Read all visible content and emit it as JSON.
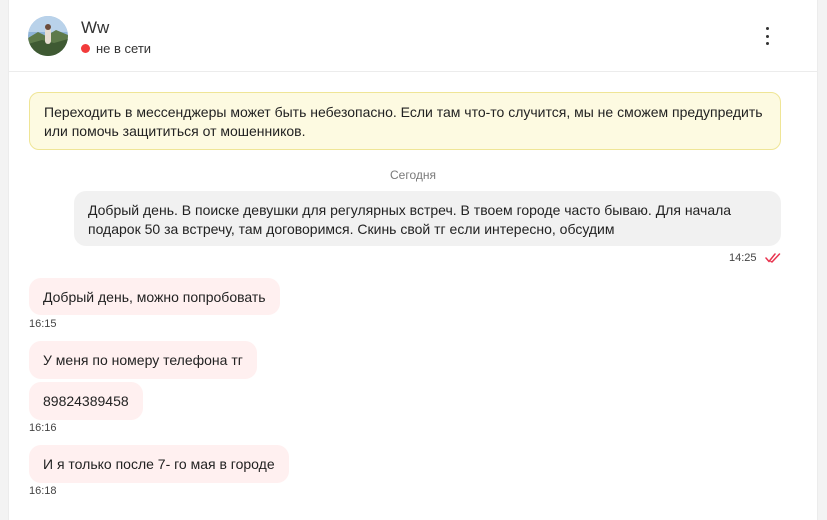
{
  "header": {
    "contact_name": "Ww",
    "status_text": "не в сети",
    "status_color": "#f23b3b"
  },
  "warning": {
    "text": "Переходить в мессенджеры может быть небезопасно. Если там что-то случится, мы не сможем предупредить или помочь защититься от мошенников."
  },
  "day_separator": "Сегодня",
  "outgoing": {
    "text": "Добрый день. В поиске девушки для регулярных встреч. В твоем городе часто бываю. Для начала подарок 50 за встречу, там договоримся. Скинь свой тг если интересно, обсудим",
    "time": "14:25",
    "read_icon": "double-check-icon"
  },
  "incoming": [
    {
      "text": "Добрый день, можно попробовать",
      "time": "16:15"
    },
    {
      "text": "У меня по номеру телефона тг",
      "time": ""
    },
    {
      "text": "89824389458",
      "time": "16:16"
    },
    {
      "text": "И я только после 7- го мая в городе",
      "time": "16:18"
    }
  ],
  "colors": {
    "incoming_bubble": "#fff0f0",
    "outgoing_bubble": "#f1f1f1",
    "warning_bg": "#fdfae1",
    "read_check": "#e8344f"
  }
}
